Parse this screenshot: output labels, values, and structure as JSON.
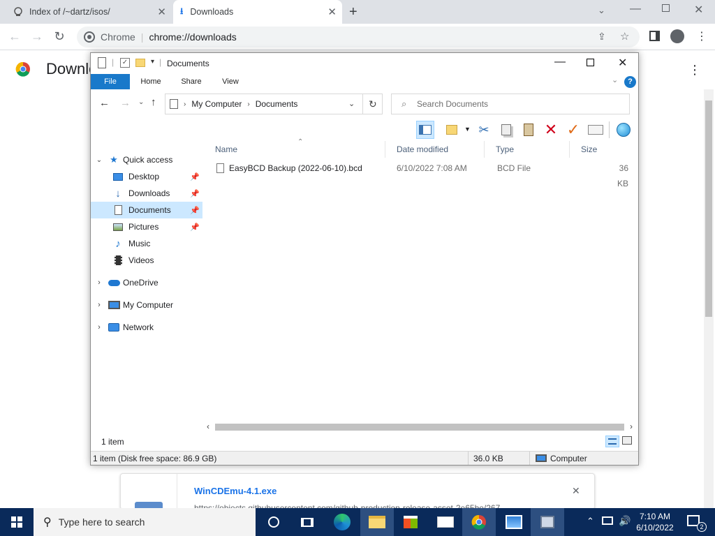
{
  "chrome": {
    "tabs": [
      {
        "label": "Index of /~dartz/isos/"
      },
      {
        "label": "Downloads"
      }
    ],
    "omnibox": {
      "site": "Chrome",
      "url": "chrome://downloads"
    },
    "page_title": "Downloads"
  },
  "explorer": {
    "title": "Documents",
    "ribbon_tabs": [
      "File",
      "Home",
      "Share",
      "View"
    ],
    "breadcrumb": [
      "My Computer",
      "Documents"
    ],
    "search_placeholder": "Search Documents",
    "columns": [
      "Name",
      "Date modified",
      "Type",
      "Size"
    ],
    "files": [
      {
        "name": "EasyBCD Backup (2022-06-10).bcd",
        "date": "6/10/2022 7:08 AM",
        "type": "BCD File",
        "size": "36 KB"
      }
    ],
    "nav": {
      "quick_access": "Quick access",
      "items": [
        {
          "label": "Desktop"
        },
        {
          "label": "Downloads"
        },
        {
          "label": "Documents"
        },
        {
          "label": "Pictures"
        },
        {
          "label": "Music"
        },
        {
          "label": "Videos"
        }
      ],
      "onedrive": "OneDrive",
      "my_computer": "My Computer",
      "network": "Network"
    },
    "item_count": "1 item",
    "status_left": "1 item (Disk free space: 86.9 GB)",
    "status_size": "36.0 KB",
    "status_location": "Computer"
  },
  "download": {
    "filename": "WinCDEmu-4.1.exe",
    "url": "https://objects.githubusercontent.com/github-production-release-asset-2e65be/267"
  },
  "taskbar": {
    "search_placeholder": "Type here to search",
    "time": "7:10 AM",
    "date": "6/10/2022",
    "notification_count": "2"
  },
  "colors": {
    "accent": "#1979ca",
    "taskbar": "#0a2a5a",
    "selection": "#cce8ff"
  }
}
